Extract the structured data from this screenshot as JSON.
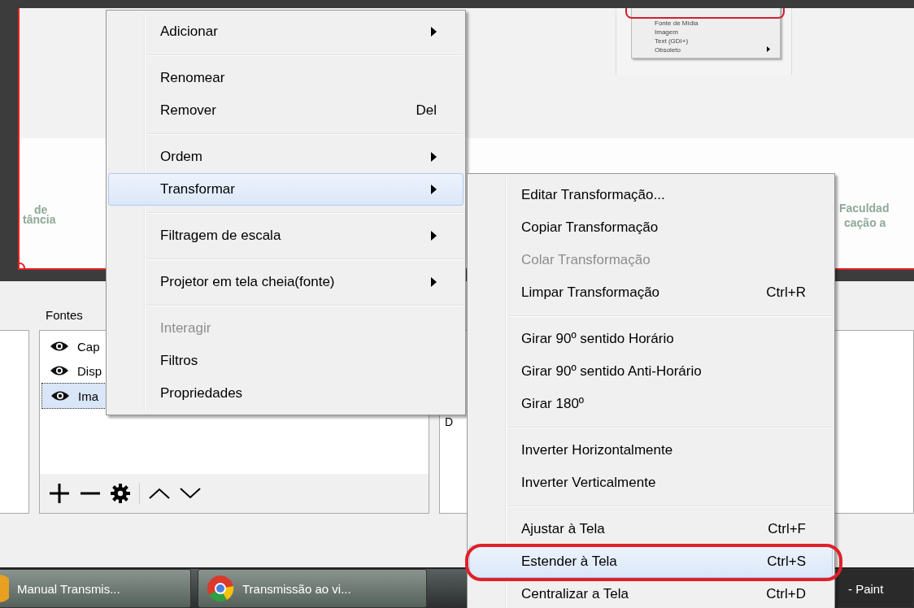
{
  "preview": {
    "logo_texts": [
      "de",
      "tância",
      "Faculdad",
      "cação a"
    ],
    "inset_menu": {
      "items": [
        {
          "label": "Fonte de Mídia",
          "submenu": false
        },
        {
          "label": "Imagem",
          "submenu": false
        },
        {
          "label": "Text (GDI+)",
          "submenu": false
        },
        {
          "label": "Obsoleto",
          "submenu": true
        }
      ]
    }
  },
  "sources_panel": {
    "title": "Fontes",
    "items": [
      {
        "label": "Cap",
        "visible": true,
        "selected": false
      },
      {
        "label": "Disp",
        "visible": true,
        "selected": false
      },
      {
        "label": "Ima",
        "visible": true,
        "selected": true
      }
    ]
  },
  "side_panel": {
    "label": "D"
  },
  "context_menu": {
    "items": [
      {
        "kind": "item",
        "label": "Adicionar",
        "submenu": true,
        "disabled": false,
        "selected": false
      },
      {
        "kind": "separator"
      },
      {
        "kind": "item",
        "label": "Renomear",
        "submenu": false,
        "disabled": false,
        "selected": false
      },
      {
        "kind": "item",
        "label": "Remover",
        "shortcut": "Del",
        "submenu": false,
        "disabled": false,
        "selected": false
      },
      {
        "kind": "separator"
      },
      {
        "kind": "item",
        "label": "Ordem",
        "submenu": true,
        "disabled": false,
        "selected": false
      },
      {
        "kind": "item",
        "label": "Transformar",
        "submenu": true,
        "disabled": false,
        "selected": true
      },
      {
        "kind": "separator"
      },
      {
        "kind": "item",
        "label": "Filtragem de escala",
        "submenu": true,
        "disabled": false,
        "selected": false
      },
      {
        "kind": "separator"
      },
      {
        "kind": "item",
        "label": "Projetor em tela cheia(fonte)",
        "submenu": true,
        "disabled": false,
        "selected": false
      },
      {
        "kind": "separator"
      },
      {
        "kind": "item",
        "label": "Interagir",
        "submenu": false,
        "disabled": true,
        "selected": false
      },
      {
        "kind": "item",
        "label": "Filtros",
        "submenu": false,
        "disabled": false,
        "selected": false
      },
      {
        "kind": "item",
        "label": "Propriedades",
        "submenu": false,
        "disabled": false,
        "selected": false
      }
    ]
  },
  "submenu": {
    "items": [
      {
        "kind": "item",
        "label": "Editar Transformação...",
        "submenu": false,
        "disabled": false,
        "selected": false
      },
      {
        "kind": "item",
        "label": "Copiar Transformação",
        "submenu": false,
        "disabled": false,
        "selected": false
      },
      {
        "kind": "item",
        "label": "Colar Transformação",
        "submenu": false,
        "disabled": true,
        "selected": false
      },
      {
        "kind": "item",
        "label": "Limpar Transformação",
        "shortcut": "Ctrl+R",
        "submenu": false,
        "disabled": false,
        "selected": false
      },
      {
        "kind": "separator"
      },
      {
        "kind": "item",
        "label": "Girar 90º sentido Horário",
        "submenu": false,
        "disabled": false,
        "selected": false
      },
      {
        "kind": "item",
        "label": "Girar 90º sentido Anti-Horário",
        "submenu": false,
        "disabled": false,
        "selected": false
      },
      {
        "kind": "item",
        "label": "Girar 180º",
        "submenu": false,
        "disabled": false,
        "selected": false
      },
      {
        "kind": "separator"
      },
      {
        "kind": "item",
        "label": "Inverter Horizontalmente",
        "submenu": false,
        "disabled": false,
        "selected": false
      },
      {
        "kind": "item",
        "label": "Inverter Verticalmente",
        "submenu": false,
        "disabled": false,
        "selected": false
      },
      {
        "kind": "separator"
      },
      {
        "kind": "item",
        "label": "Ajustar à Tela",
        "shortcut": "Ctrl+F",
        "submenu": false,
        "disabled": false,
        "selected": false
      },
      {
        "kind": "item",
        "label": "Estender à Tela",
        "shortcut": "Ctrl+S",
        "submenu": false,
        "disabled": false,
        "selected": true
      },
      {
        "kind": "item",
        "label": "Centralizar a Tela",
        "shortcut": "Ctrl+D",
        "submenu": false,
        "disabled": false,
        "selected": false
      }
    ]
  },
  "taskbar": {
    "buttons": [
      {
        "kind": "document",
        "label": "Manual Transmis..."
      },
      {
        "kind": "browser",
        "label": "Transmissão ao vi..."
      },
      {
        "kind": "plain",
        "label": "- Paint"
      }
    ]
  }
}
